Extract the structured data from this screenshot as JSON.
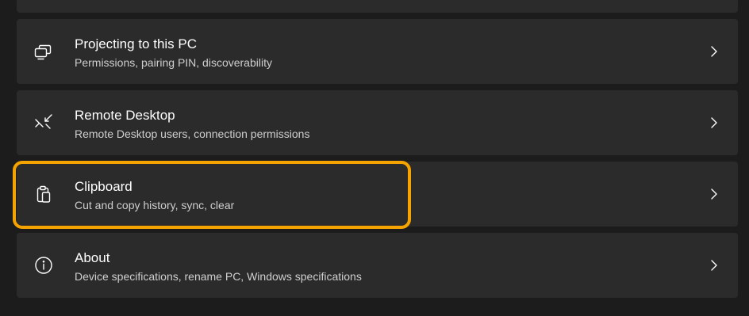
{
  "settings": {
    "items": [
      {
        "title": "Projecting to this PC",
        "subtitle": "Permissions, pairing PIN, discoverability",
        "icon": "projecting-icon"
      },
      {
        "title": "Remote Desktop",
        "subtitle": "Remote Desktop users, connection permissions",
        "icon": "remote-desktop-icon"
      },
      {
        "title": "Clipboard",
        "subtitle": "Cut and copy history, sync, clear",
        "icon": "clipboard-icon"
      },
      {
        "title": "About",
        "subtitle": "Device specifications, rename PC, Windows specifications",
        "icon": "info-icon"
      }
    ]
  },
  "colors": {
    "background": "#1c1c1c",
    "card": "#2b2b2b",
    "highlight": "#f5a300",
    "title_text": "#ffffff",
    "subtitle_text": "#cfcfcf"
  }
}
